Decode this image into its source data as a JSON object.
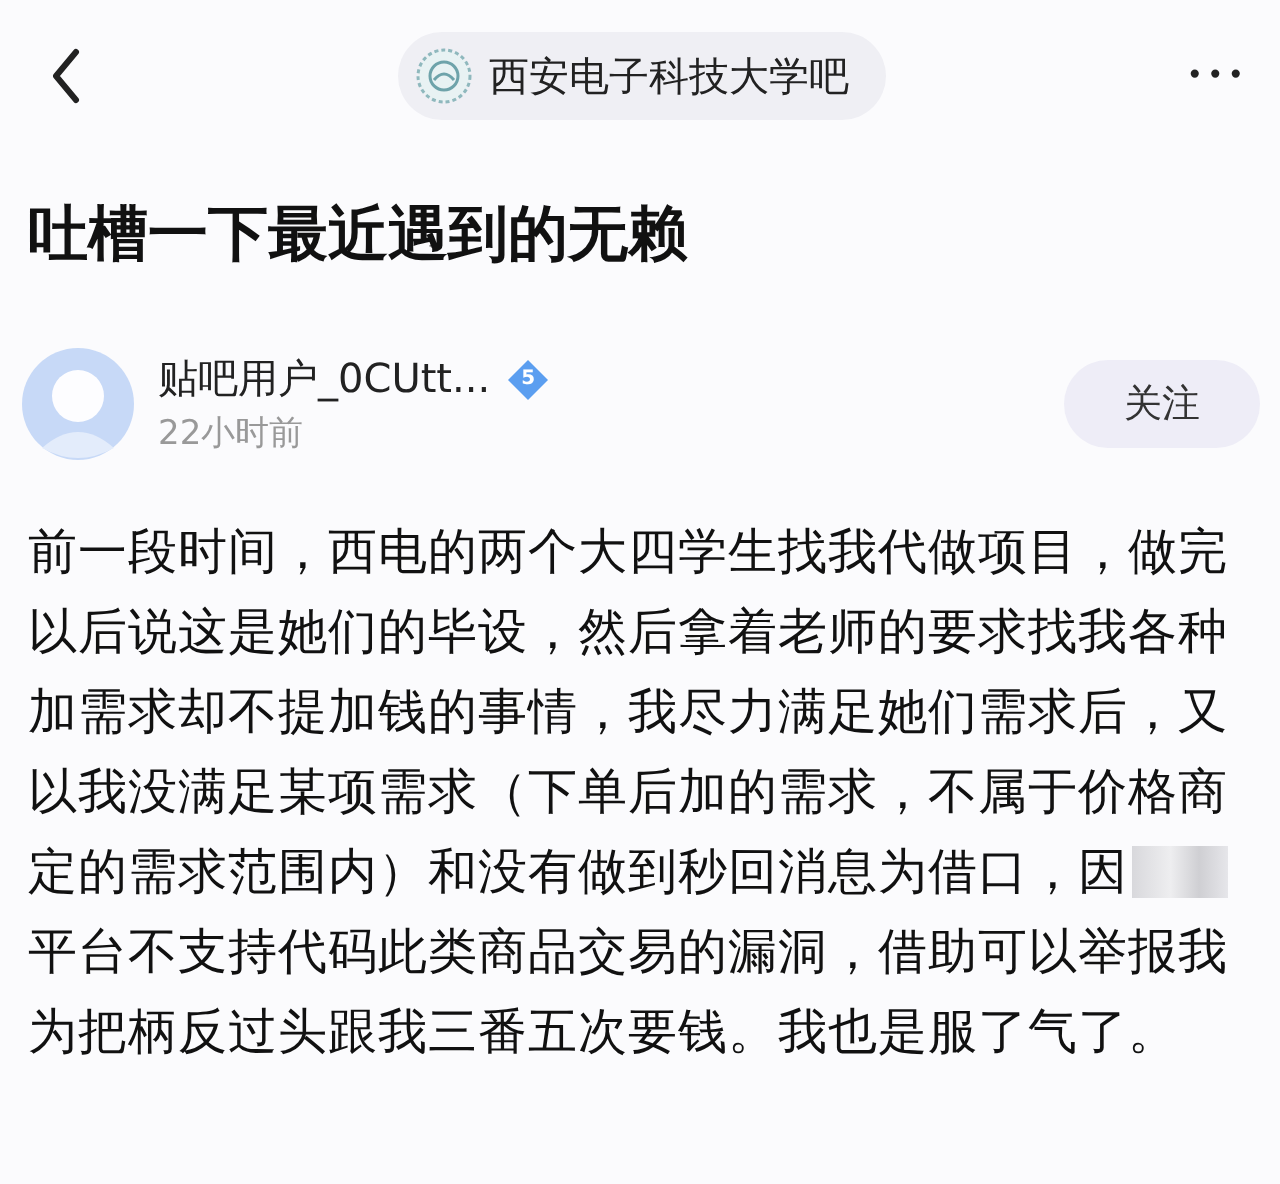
{
  "header": {
    "forum": {
      "name": "西安电子科技大学吧"
    },
    "more": "•••"
  },
  "post": {
    "title": "吐槽一下最近遇到的无赖",
    "author": {
      "name": "贴吧用户_0CUtt...",
      "level": "5",
      "time": "22小时前",
      "follow": "关注"
    },
    "body_start": "前一段时间，西电的两个大四学生找我代做项目，做完以后说这是她们的毕设，然后拿着老师的要求找我各种加需求却不提加钱的事情，我尽力满足她们需求后，又以我没满足某项需求（下单后加的需求，不属于价格商",
    "body_before_blur": "定的需求范围内）和没有做到秒回消息为借口，因",
    "body_after_blur": "平台不支持代码此类商品交易的漏洞，借助可以举报我为把柄反过头跟我三番五次要钱。我也是服了气了。"
  }
}
